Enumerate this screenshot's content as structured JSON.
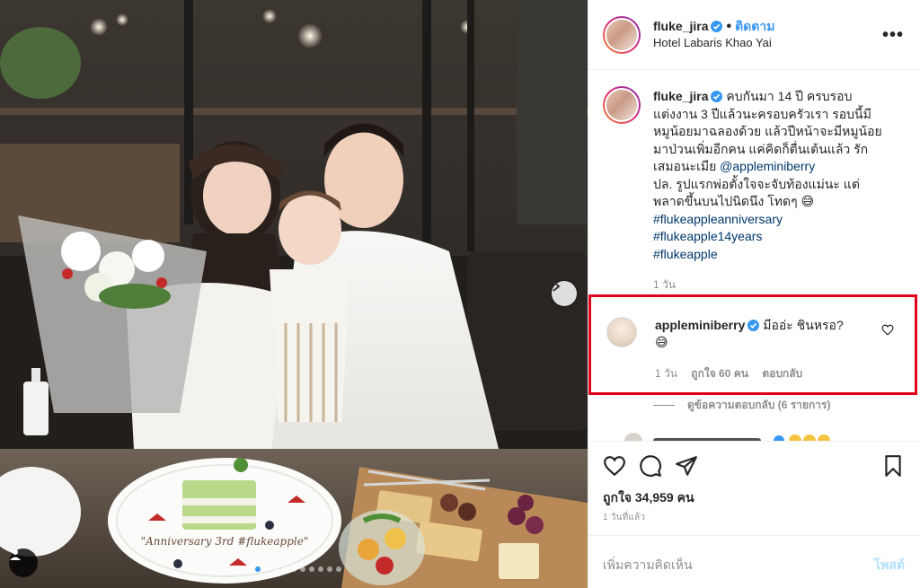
{
  "header": {
    "username": "fluke_jira",
    "follow_label": "ติดตาม",
    "separator": "•",
    "location": "Hotel Labaris Khao Yai",
    "more_label": "•••"
  },
  "caption": {
    "username": "fluke_jira",
    "line1": "คบกันมา 14 ปี ครบรอบ",
    "line2": "แต่งงาน 3 ปีแล้วนะครอบครัวเรา รอบนี้มี",
    "line3": "หมูน้อยมาฉลองด้วย แล้วปีหน้าจะมีหมูน้อย",
    "line4": "มาป่วนเพิ่มอีกคน แค่คิดก็ตื่นเต้นแล้ว รัก",
    "line5_prefix": "เสมอนะเมีย",
    "mention": "@appleminiberry",
    "line6": "ปล. รูปแรกพ่อตั้งใจจะจับท้องแม่นะ แต่",
    "line7": "พลาดขึ้นบนไปนิดนึง โทดๆ 😅",
    "hashtags": [
      "#flukeappleanniversary",
      "#flukeapple14years",
      "#flukeapple"
    ],
    "time": "1 วัน"
  },
  "comment": {
    "username": "appleminiberry",
    "text": "มีออ่ะ ชินหรอ?",
    "emoji": "😅",
    "time": "1 วัน",
    "likes": "ถูกใจ 60 คน",
    "reply_label": "ตอบกลับ"
  },
  "view_replies": "ดูข้อความตอบกลับ (6 รายการ)",
  "actions": {
    "likes": "ถูกใจ 34,959 คน",
    "posted_ago": "1 วันที่แล้ว"
  },
  "add_comment": {
    "placeholder": "เพิ่มความคิดเห็น",
    "post_label": "โพสต์"
  },
  "photo": {
    "plate_text": "\"Anniversary 3rd #flukeapple\"",
    "carousel_count": 10,
    "carousel_active": 1
  },
  "colors": {
    "link": "#00376b",
    "accent": "#3897f0",
    "highlight_border": "#e0001a",
    "muted": "#8e8e8e"
  },
  "icons": [
    "verified-icon",
    "more-icon",
    "heart-icon",
    "comment-icon",
    "share-icon",
    "bookmark-icon",
    "next-arrow-icon",
    "tag-user-icon"
  ]
}
